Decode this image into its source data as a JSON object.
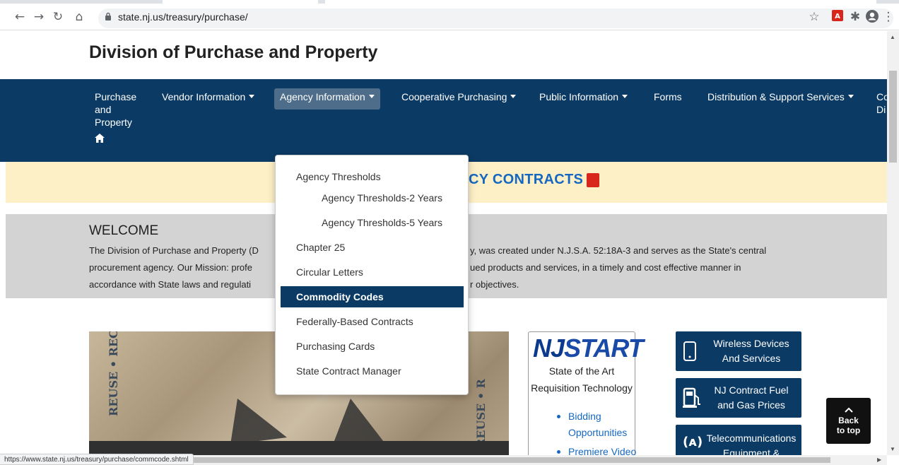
{
  "browser": {
    "url": "state.nj.us/treasury/purchase/",
    "status_url": "https://www.state.nj.us/treasury/purchase/commcode.shtml"
  },
  "site": {
    "title": "Division of Purchase and Property"
  },
  "nav": {
    "home_lines": [
      "Purchase",
      "and",
      "Property"
    ],
    "items": [
      {
        "label": "Vendor Information"
      },
      {
        "label": "Agency Information"
      },
      {
        "label": "Cooperative Purchasing"
      },
      {
        "label": "Public Information"
      },
      {
        "label": "Forms"
      },
      {
        "label": "Distribution & Support Services"
      },
      {
        "label": "Co"
      },
      {
        "label": "Di"
      }
    ]
  },
  "banner": {
    "text": "CY CONTRACTS"
  },
  "welcome": {
    "heading": "WELCOME",
    "left_lines": [
      "The Division of Purchase and Property (D",
      "procurement agency. Our Mission: profe",
      "accordance with State laws and regulati"
    ],
    "right_lines": [
      "y, was created under N.J.S.A. 52:18A-3 and serves as the State's central",
      "ued products and services, in a timely and cost effective manner in",
      "r objectives."
    ]
  },
  "dropdown": {
    "items": [
      {
        "label": "Agency Thresholds"
      },
      {
        "label": "Agency Thresholds-2 Years"
      },
      {
        "label": "Agency Thresholds-5 Years"
      },
      {
        "label": "Chapter 25"
      },
      {
        "label": "Circular Letters"
      },
      {
        "label": "Commodity Codes"
      },
      {
        "label": "Federally-Based Contracts"
      },
      {
        "label": "Purchasing Cards"
      },
      {
        "label": "State Contract Manager"
      }
    ]
  },
  "njstart": {
    "logo_nj": "NJ",
    "logo_start": "START",
    "line1": "State of the Art",
    "line2": "Requisition Technology",
    "links": [
      "Bidding",
      "Opportunities",
      "Premiere Video"
    ]
  },
  "services": [
    {
      "line1": "Wireless Devices",
      "line2": "And Services"
    },
    {
      "line1": "NJ Contract Fuel",
      "line2": "and Gas Prices"
    },
    {
      "line1": "Telecommunications",
      "line2": "Equipment &"
    }
  ],
  "back_to_top": {
    "line1": "Back",
    "line2": "to top"
  },
  "colors": {
    "nav_bg": "#0b3a64",
    "banner_bg": "#fdefc6",
    "link": "#1468c2",
    "active_item": "#0b3a64"
  }
}
